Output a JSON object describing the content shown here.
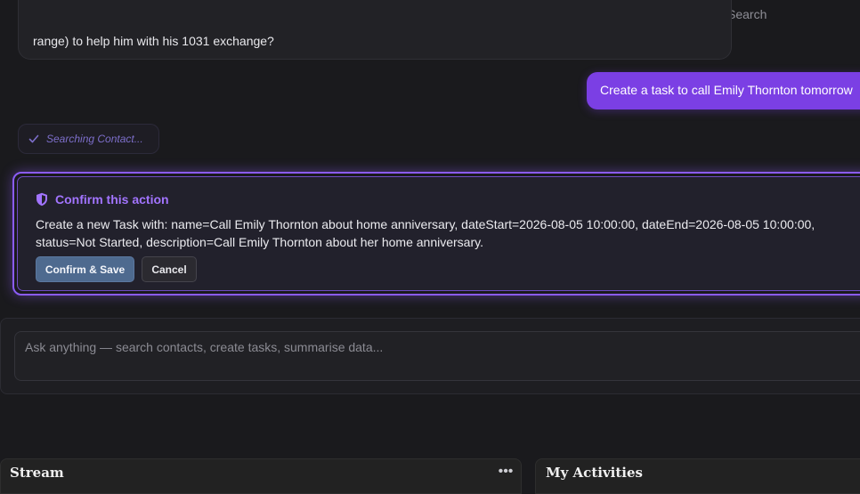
{
  "header": {
    "search_label": "Search"
  },
  "chat": {
    "previous_message_tail": "range) to help him with his 1031 exchange?",
    "user_message": "Create a task to call Emily Thornton tomorrow",
    "tool_status": {
      "icon": "check-icon",
      "text": "Searching Contact..."
    }
  },
  "confirm": {
    "icon": "shield-icon",
    "title": "Confirm this action",
    "body": "Create a new Task with: name=Call Emily Thornton about home anniversary, dateStart=2026-08-05 10:00:00, dateEnd=2026-08-05 10:00:00, status=Not Started, description=Call Emily Thornton about her home anniversary.",
    "confirm_label": "Confirm & Save",
    "cancel_label": "Cancel"
  },
  "composer": {
    "placeholder": "Ask anything — search contacts, create tasks, summarise data..."
  },
  "dashboard": {
    "stream": {
      "title": "Stream",
      "more_icon": "more-horizontal-icon"
    },
    "activities": {
      "title": "My Activities"
    }
  },
  "colors": {
    "accent": "#7b3fe4",
    "confirm_border": "#8b5cf6",
    "confirm_title": "#a274ff",
    "confirm_button": "#4e6a8f"
  }
}
